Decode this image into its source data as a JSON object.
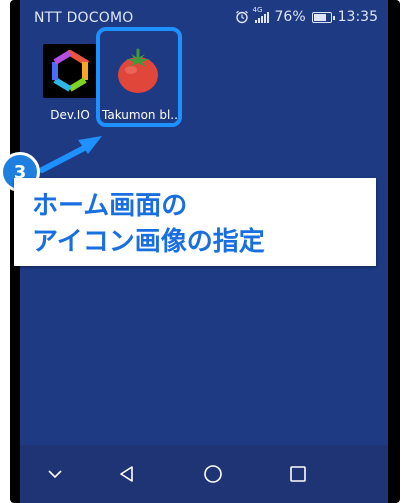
{
  "status_bar": {
    "carrier": "NTT DOCOMO",
    "signal_label": "4G",
    "battery_percent": "76%",
    "battery_level": 0.76,
    "time": "13:35"
  },
  "apps": [
    {
      "label": "Dev.IO",
      "icon": "devio-logo-icon"
    },
    {
      "label": "Takumon bl..",
      "icon": "tomato-icon"
    }
  ],
  "annotation": {
    "step_number": "3",
    "callout_line1": "ホーム画面の",
    "callout_line2": "アイコン画像の指定",
    "accent_color": "#1a6fe0"
  },
  "nav_bar": {
    "buttons": [
      "chevron-down-icon",
      "back-triangle-icon",
      "home-circle-icon",
      "recents-square-icon"
    ]
  }
}
